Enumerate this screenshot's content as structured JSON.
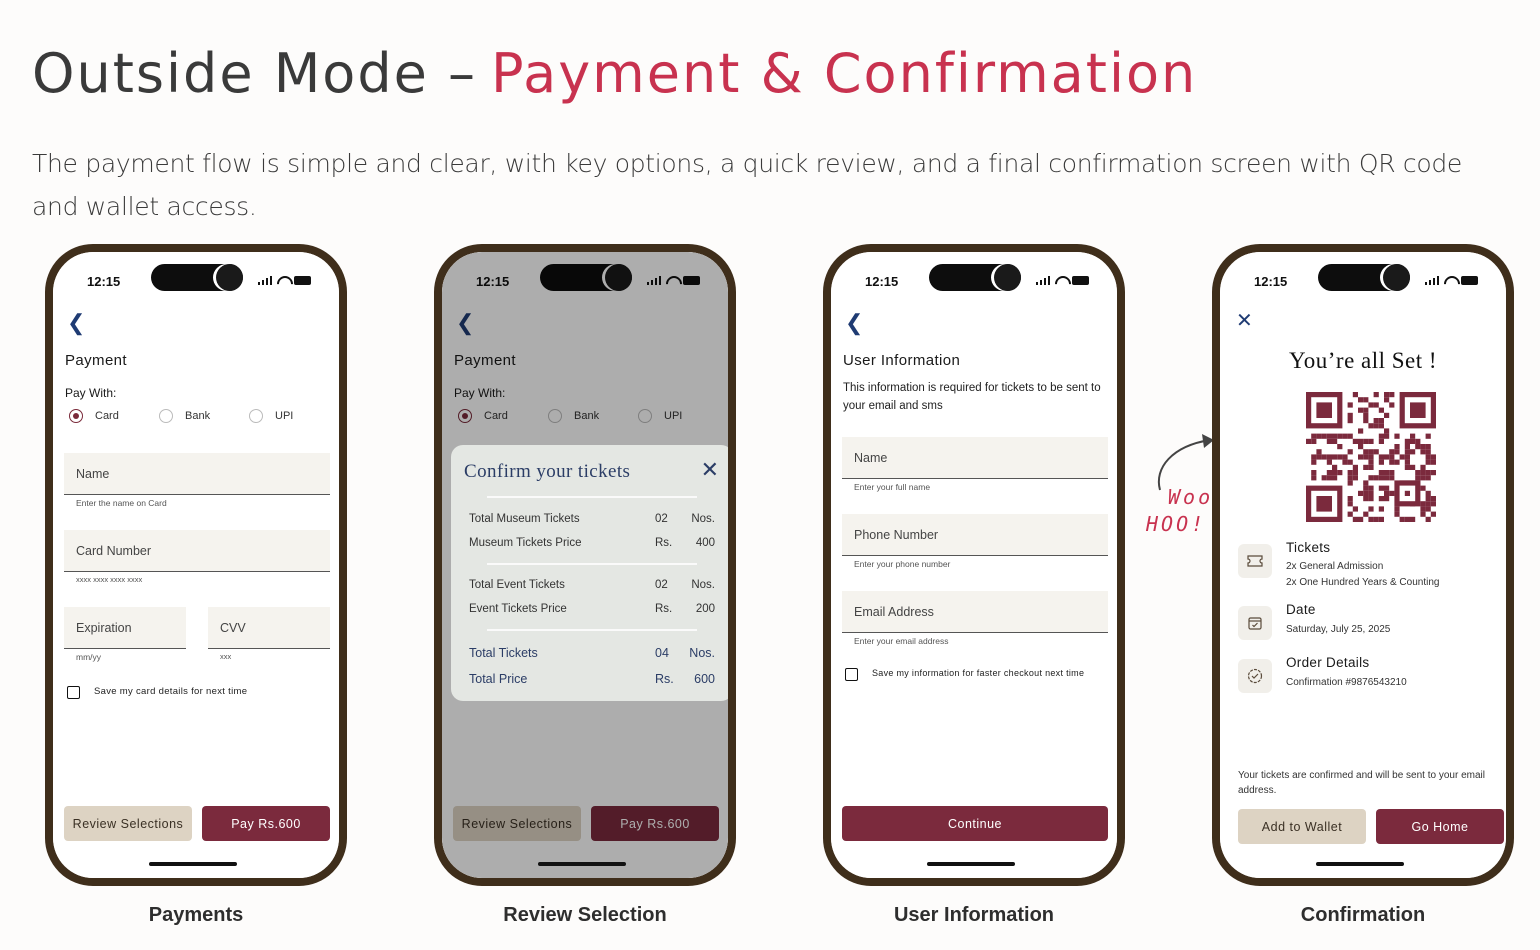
{
  "header": {
    "title_part1": "Outside Mode –",
    "title_part2": "Payment & Confirmation",
    "description": "The payment flow is simple and clear, with key options, a quick review, and a final confirmation screen with QR code and wallet access."
  },
  "colors": {
    "accent": "#c8324f",
    "brand_dark": "#7b2a3d",
    "brand_light": "#ddd3c3",
    "frame": "#3f2e1b",
    "modal_text": "#2b3d66"
  },
  "status_time": "12:15",
  "payment": {
    "title": "Payment",
    "pay_with": "Pay With:",
    "methods": [
      "Card",
      "Bank",
      "UPI"
    ],
    "selected_method": "Card",
    "name_label": "Name",
    "name_hint": "Enter the name on Card",
    "card_label": "Card Number",
    "card_hint": "xxxx   xxxx   xxxx   xxxx",
    "exp_label": "Expiration",
    "exp_hint": "mm/yy",
    "cvv_label": "CVV",
    "cvv_hint": "xxx",
    "save_label": "Save my card details for next time",
    "review_btn": "Review Selections",
    "pay_btn": "Pay Rs.600",
    "caption": "Payments"
  },
  "review": {
    "modal_title": "Confirm your tickets",
    "rows": [
      {
        "label": "Total Museum Tickets",
        "mid": "02",
        "val": "Nos."
      },
      {
        "label": "Museum Tickets Price",
        "mid": "Rs.",
        "val": "400"
      },
      {
        "label": "Total Event Tickets",
        "mid": "02",
        "val": "Nos."
      },
      {
        "label": "Event Tickets Price",
        "mid": "Rs.",
        "val": "200"
      },
      {
        "label": "Total Tickets",
        "mid": "04",
        "val": "Nos."
      },
      {
        "label": "Total Price",
        "mid": "Rs.",
        "val": "600"
      }
    ],
    "caption": "Review Selection"
  },
  "user_info": {
    "title": "User Information",
    "subtitle": "This information is required for tickets to be sent to your email and sms",
    "name_label": "Name",
    "name_hint": "Enter your full name",
    "phone_label": "Phone Number",
    "phone_hint": "Enter your phone number",
    "email_label": "Email Address",
    "email_hint": "Enter your email address",
    "save_label": "Save my information for faster checkout next time",
    "continue_btn": "Continue",
    "caption": "User Information"
  },
  "woo": {
    "line1": "Woo",
    "line2": "HOO!"
  },
  "confirmation": {
    "title": "You’re all Set !",
    "tickets_title": "Tickets",
    "tickets_line1": "2x General Admission",
    "tickets_line2": "2x One Hundred Years & Counting",
    "date_title": "Date",
    "date_value": "Saturday, July 25, 2025",
    "order_title": "Order Details",
    "order_value": "Confirmation #9876543210",
    "note": "Your tickets are confirmed and will be sent to your email address.",
    "wallet_btn": "Add to Wallet",
    "home_btn": "Go Home",
    "caption": "Confirmation"
  }
}
